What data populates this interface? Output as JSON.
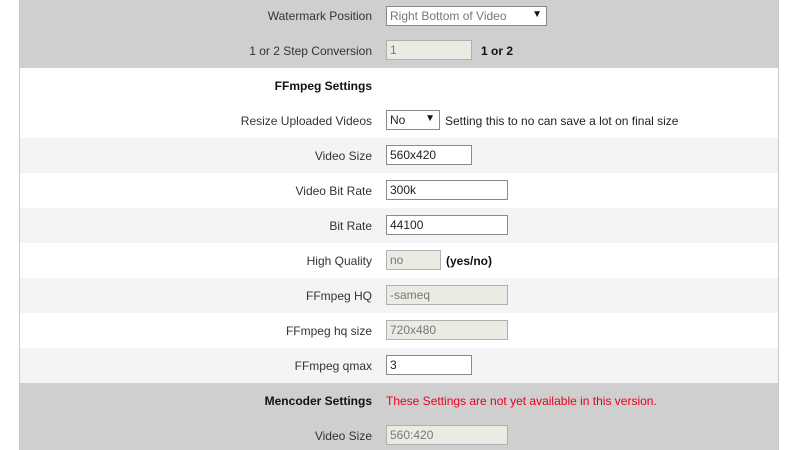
{
  "rows": {
    "watermark_position": {
      "label": "Watermark Position",
      "value": "Right Bottom of Video"
    },
    "step_conversion": {
      "label": "1 or 2 Step Conversion",
      "value": "1",
      "hint": "1 or 2"
    },
    "ffmpeg_header": {
      "label": "FFmpeg Settings"
    },
    "resize_videos": {
      "label": "Resize Uploaded Videos",
      "value": "No",
      "hint": "Setting this to no can save a lot on final size"
    },
    "video_size": {
      "label": "Video Size",
      "value": "560x420"
    },
    "video_bit_rate": {
      "label": "Video Bit Rate",
      "value": "300k"
    },
    "bit_rate": {
      "label": "Bit Rate",
      "value": "44100"
    },
    "high_quality": {
      "label": "High Quality",
      "value": "no",
      "hint": "(yes/no)"
    },
    "ffmpeg_hq": {
      "label": "FFmpeg HQ",
      "value": "-sameq"
    },
    "ffmpeg_hq_size": {
      "label": "FFmpeg hq size",
      "value": "720x480"
    },
    "ffmpeg_qmax": {
      "label": "FFmpeg qmax",
      "value": "3"
    },
    "mencoder_header": {
      "label": "Mencoder Settings",
      "notice": "These Settings are not yet available in this version."
    },
    "mencoder_video_size": {
      "label": "Video Size",
      "value": "560:420"
    }
  },
  "icons": {
    "dropdown": "chevron-down-icon"
  },
  "colors": {
    "notice_red": "#e8001c",
    "row_dark": "#cfcfcf",
    "row_light": "#f4f4f4"
  }
}
